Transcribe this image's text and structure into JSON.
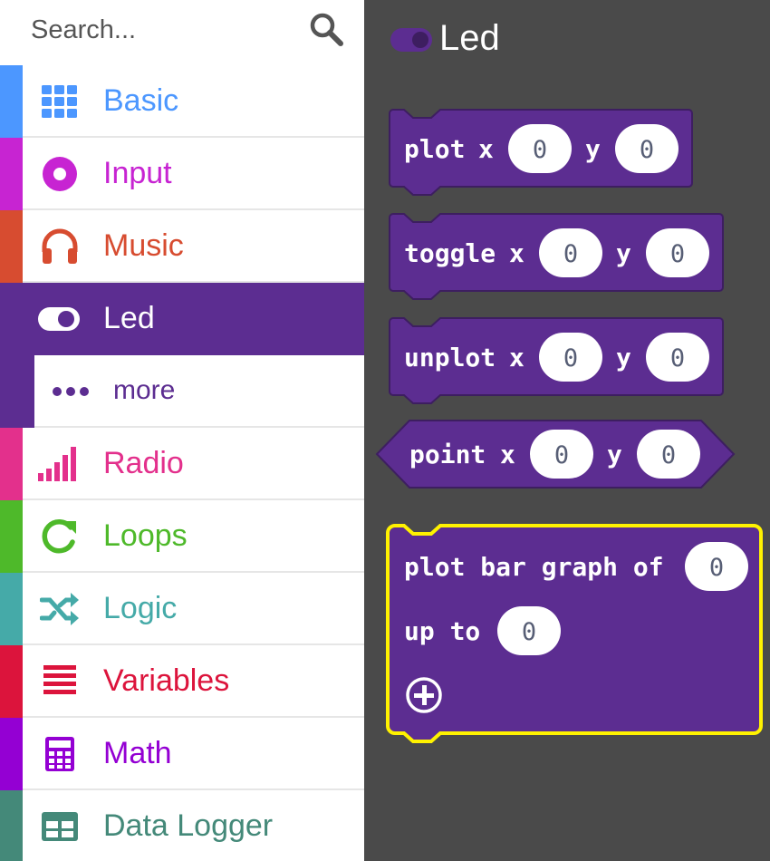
{
  "search": {
    "placeholder": "Search..."
  },
  "categories": [
    {
      "label": "Basic",
      "color": "#4c97ff",
      "icon": "grid-icon"
    },
    {
      "label": "Input",
      "color": "#c724d2",
      "icon": "target-icon"
    },
    {
      "label": "Music",
      "color": "#d74c30",
      "icon": "headphones-icon"
    },
    {
      "label": "Led",
      "color": "#5c2d91",
      "icon": "toggle-icon",
      "selected": true
    },
    {
      "label": "more",
      "color": "#5c2d91",
      "icon": "ellipsis-icon",
      "sub": true
    },
    {
      "label": "Radio",
      "color": "#e3308c",
      "icon": "signal-icon"
    },
    {
      "label": "Loops",
      "color": "#4eb92a",
      "icon": "refresh-icon"
    },
    {
      "label": "Logic",
      "color": "#45aaa8",
      "icon": "shuffle-icon"
    },
    {
      "label": "Variables",
      "color": "#dc143c",
      "icon": "list-icon"
    },
    {
      "label": "Math",
      "color": "#9400d3",
      "icon": "calculator-icon"
    },
    {
      "label": "Data Logger",
      "color": "#448979",
      "icon": "table-icon"
    }
  ],
  "flyout": {
    "title": "Led",
    "blocks": [
      {
        "kind": "statement",
        "words": [
          "plot",
          "x"
        ],
        "x_value": "0",
        "y_word": "y",
        "y_value": "0"
      },
      {
        "kind": "statement",
        "words": [
          "toggle",
          "x"
        ],
        "x_value": "0",
        "y_word": "y",
        "y_value": "0"
      },
      {
        "kind": "statement",
        "words": [
          "unplot",
          "x"
        ],
        "x_value": "0",
        "y_word": "y",
        "y_value": "0"
      },
      {
        "kind": "reporter",
        "words": [
          "point",
          "x"
        ],
        "x_value": "0",
        "y_word": "y",
        "y_value": "0"
      }
    ],
    "bar_graph": {
      "line1": "plot bar graph of",
      "value1": "0",
      "line2": "up to",
      "value2": "0"
    }
  },
  "colors": {
    "led_block": "#5c2d91",
    "block_border": "#3d1e60",
    "highlight": "#fff200",
    "workspace": "#4a4a4a"
  }
}
